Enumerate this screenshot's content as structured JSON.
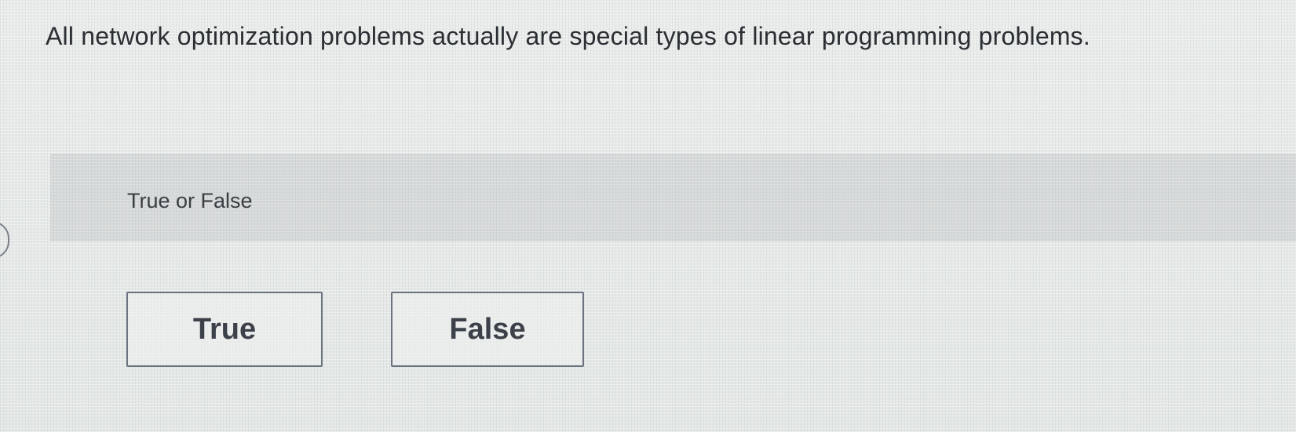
{
  "question": {
    "text": "All network optimization problems actually are special types of linear programming problems."
  },
  "prompt": {
    "text": "True or False"
  },
  "choices": {
    "true_label": "True",
    "false_label": "False"
  }
}
